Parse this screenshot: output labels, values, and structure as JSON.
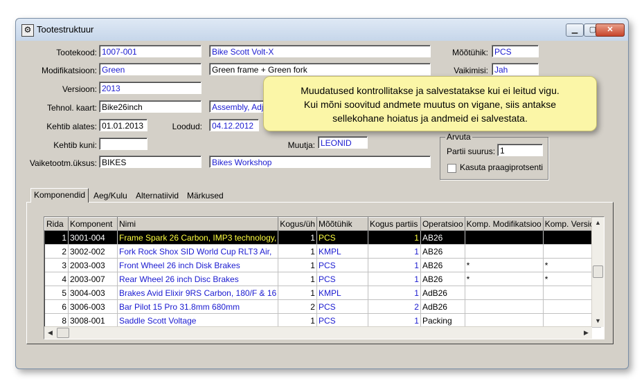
{
  "window": {
    "title": "Tootestruktuur",
    "buttons": {
      "minimize": "▁",
      "maximize": "▢",
      "close": "✕"
    }
  },
  "form": {
    "tootekood": {
      "label": "Tootekood:",
      "code": "1007-001",
      "name": "Bike Scott Volt-X"
    },
    "modifikatsioon": {
      "label": "Modifikatsioon:",
      "value": "Green",
      "desc": "Green frame + Green fork"
    },
    "versioon": {
      "label": "Versioon:",
      "value": "2013"
    },
    "tehnol_kaart": {
      "label": "Tehnol. kaart:",
      "value": "Bike26inch",
      "desc": "Assembly, Adju"
    },
    "kehtib_alates": {
      "label": "Kehtib alates:",
      "value": "01.01.2013"
    },
    "loodud": {
      "label": "Loodud:",
      "value": "04.12.2012"
    },
    "kehtib_kuni": {
      "label": "Kehtib kuni:",
      "value": ""
    },
    "muutja": {
      "label": "Muutja:",
      "value": "LEONID"
    },
    "vaiketootm": {
      "label": "Vaiketootm.üksus:",
      "value": "BIKES",
      "desc": "Bikes Workshop"
    },
    "mootuhik": {
      "label": "Mõõtühik:",
      "value": "PCS"
    },
    "vaikimisi": {
      "label": "Vaikimisi:",
      "value": "Jah"
    },
    "arvuta": {
      "title": "Arvuta",
      "partii_label": "Partii suurus:",
      "partii_value": "1",
      "kasuta_label": "Kasuta praagiprotsenti"
    }
  },
  "tabs": [
    "Komponendid",
    "Aeg/Kulu",
    "Alternatiivid",
    "Märkused"
  ],
  "grid": {
    "columns": [
      "Rida",
      "Komponent",
      "Nimi",
      "Kogus/üh",
      "Mõõtühik",
      "Kogus partiis",
      "Operatsioo",
      "Komp. Modifikatsioo",
      "Komp. Versioo"
    ],
    "rows": [
      {
        "rida": "1",
        "komponent": "3001-004",
        "nimi": "Frame Spark 26 Carbon, IMP3 technology,",
        "kogus": "1",
        "uhik": "PCS",
        "partii": "1",
        "oper": "AB26",
        "mod": "",
        "ver": ""
      },
      {
        "rida": "2",
        "komponent": "3002-002",
        "nimi": "Fork Rock Shox SID World Cup RLT3 Air,",
        "kogus": "1",
        "uhik": "KMPL",
        "partii": "1",
        "oper": "AB26",
        "mod": "",
        "ver": ""
      },
      {
        "rida": "3",
        "komponent": "2003-003",
        "nimi": "Front Wheel 26 inch Disk Brakes",
        "kogus": "1",
        "uhik": "PCS",
        "partii": "1",
        "oper": "AB26",
        "mod": "*",
        "ver": "*"
      },
      {
        "rida": "4",
        "komponent": "2003-007",
        "nimi": "Rear Wheel 26 inch Disc Brakes",
        "kogus": "1",
        "uhik": "PCS",
        "partii": "1",
        "oper": "AB26",
        "mod": "*",
        "ver": "*"
      },
      {
        "rida": "5",
        "komponent": "3004-003",
        "nimi": "Brakes Avid Elixir 9RS Carbon, 180/F & 16",
        "kogus": "1",
        "uhik": "KMPL",
        "partii": "1",
        "oper": "AdB26",
        "mod": "",
        "ver": ""
      },
      {
        "rida": "6",
        "komponent": "3006-003",
        "nimi": "Bar Pilot 15 Pro 31.8mm 680mm",
        "kogus": "2",
        "uhik": "PCS",
        "partii": "2",
        "oper": "AdB26",
        "mod": "",
        "ver": ""
      },
      {
        "rida": "8",
        "komponent": "3008-001",
        "nimi": "Saddle Scott Voltage",
        "kogus": "1",
        "uhik": "PCS",
        "partii": "1",
        "oper": "Packing",
        "mod": "",
        "ver": ""
      }
    ]
  },
  "tooltip": {
    "line1": "Muudatused kontrollitakse ja salvestatakse kui ei leitud vigu.",
    "line2": "Kui mõni soovitud andmete muutus on vigane, siis antakse",
    "line3": "sellekohane hoiatus ja andmeid ei salvestata."
  }
}
